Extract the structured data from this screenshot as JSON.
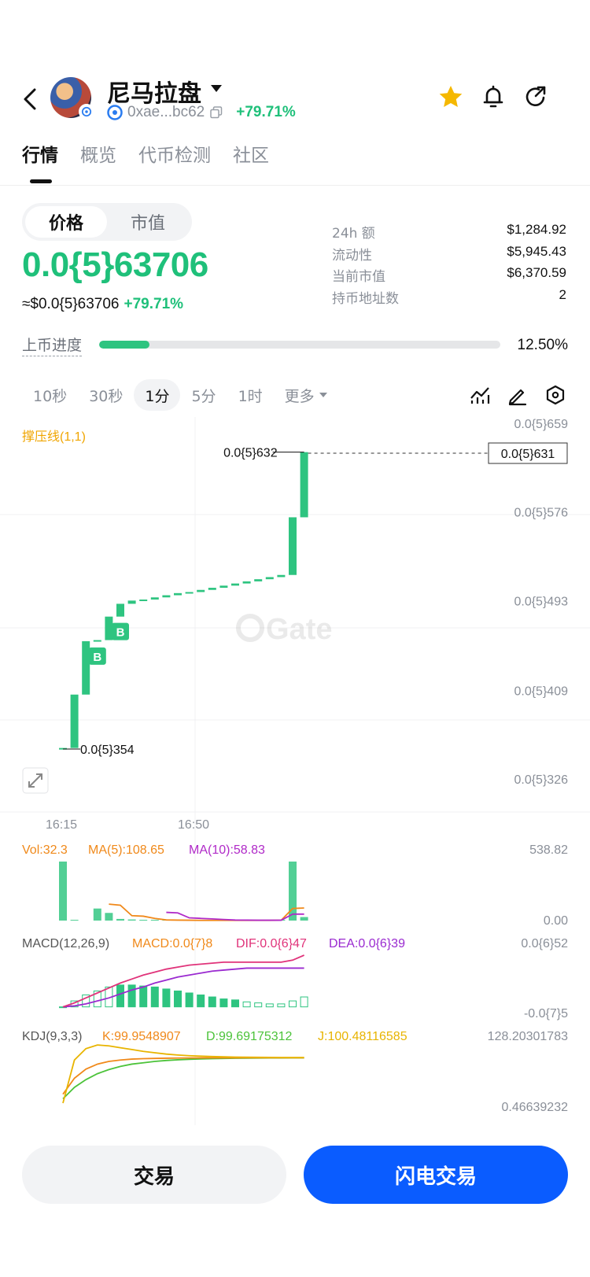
{
  "header": {
    "token_name": "尼马拉盘",
    "address": "0xae...bc62",
    "change": "+79.71%"
  },
  "tabs": [
    {
      "label": "行情",
      "active": true
    },
    {
      "label": "概览",
      "active": false
    },
    {
      "label": "代币检测",
      "active": false
    },
    {
      "label": "社区",
      "active": false
    }
  ],
  "price_toggle": {
    "price_label": "价格",
    "mcap_label": "市值"
  },
  "price": {
    "main": "0.0{5}63706",
    "usd": "≈$0.0{5}63706",
    "change": "+79.71%"
  },
  "stats": [
    {
      "label": "24h  额",
      "value": "$1,284.92"
    },
    {
      "label": "流动性",
      "value": "$5,945.43"
    },
    {
      "label": "当前市值",
      "value": "$6,370.59"
    },
    {
      "label": "持币地址数",
      "value": "2"
    }
  ],
  "progress": {
    "label": "上币进度",
    "value": "12.50%",
    "fraction": 0.125
  },
  "intervals": [
    {
      "label": "10秒",
      "active": false
    },
    {
      "label": "30秒",
      "active": false
    },
    {
      "label": "1分",
      "active": true
    },
    {
      "label": "5分",
      "active": false
    },
    {
      "label": "1时",
      "active": false
    },
    {
      "label": "更多",
      "active": false
    }
  ],
  "colors": {
    "up": "#2ec480",
    "accent_blue": "#0a5cff",
    "star": "#f5b800",
    "sr_line": "#f0a500"
  },
  "chart_data": {
    "type": "candlestick",
    "indicator_label": "撑压线(1,1)",
    "y_ticks": [
      "0.0{5}659",
      "0.0{5}576",
      "0.0{5}493",
      "0.0{5}409",
      "0.0{5}326"
    ],
    "y_tick_values": [
      6.59,
      5.76,
      4.93,
      4.09,
      3.26
    ],
    "x_ticks": [
      "16:15",
      "16:50"
    ],
    "high_label": "0.0{5}632",
    "low_label": "0.0{5}354",
    "current_label": "0.0{5}631",
    "current_value": 6.31,
    "watermark": "Gate",
    "candles": [
      {
        "o": 3.54,
        "c": 3.55
      },
      {
        "o": 3.55,
        "c": 4.05
      },
      {
        "o": 4.05,
        "c": 4.55
      },
      {
        "o": 4.55,
        "c": 4.56
      },
      {
        "o": 4.56,
        "c": 4.78
      },
      {
        "o": 4.78,
        "c": 4.9
      },
      {
        "o": 4.9,
        "c": 4.93
      },
      {
        "o": 4.93,
        "c": 4.94
      },
      {
        "o": 4.94,
        "c": 4.96
      },
      {
        "o": 4.96,
        "c": 4.98
      },
      {
        "o": 4.98,
        "c": 5.0
      },
      {
        "o": 5.0,
        "c": 5.01
      },
      {
        "o": 5.01,
        "c": 5.03
      },
      {
        "o": 5.03,
        "c": 5.05
      },
      {
        "o": 5.05,
        "c": 5.07
      },
      {
        "o": 5.07,
        "c": 5.09
      },
      {
        "o": 5.09,
        "c": 5.11
      },
      {
        "o": 5.11,
        "c": 5.13
      },
      {
        "o": 5.13,
        "c": 5.15
      },
      {
        "o": 5.15,
        "c": 5.17
      },
      {
        "o": 5.17,
        "c": 5.71
      },
      {
        "o": 5.71,
        "c": 6.32
      }
    ],
    "buy_markers": [
      {
        "index": 3,
        "label": "B"
      },
      {
        "index": 5,
        "label": "B"
      }
    ],
    "volume": {
      "label": "Vol:32.3",
      "ma5_label": "MA(5):108.65",
      "ma10_label": "MA(10):58.83",
      "max_label": "538.82",
      "min_label": "0.00",
      "max": 538.82,
      "bars": [
        538.82,
        5,
        0,
        110,
        70,
        15,
        10,
        5,
        3,
        2,
        2,
        2,
        2,
        2,
        2,
        2,
        2,
        2,
        2,
        5,
        538.82,
        32.3
      ],
      "ma5": [
        null,
        null,
        null,
        null,
        150,
        140,
        45,
        40,
        20,
        6,
        4,
        3,
        2,
        2,
        2,
        2,
        2,
        2,
        2,
        3,
        110,
        115
      ],
      "ma10": [
        null,
        null,
        null,
        null,
        null,
        null,
        null,
        null,
        null,
        75,
        70,
        25,
        20,
        15,
        10,
        5,
        4,
        3,
        3,
        3,
        58.83,
        58.83
      ]
    },
    "macd": {
      "label": "MACD(12,26,9)",
      "macd_label": "MACD:0.0{7}8",
      "dif_label": "DIF:0.0{6}47",
      "dea_label": "DEA:0.0{6}39",
      "max_label": "0.0{6}52",
      "min_label": "-0.0{7}5",
      "max": 0.52,
      "min": -0.05,
      "dif": [
        0.0,
        0.04,
        0.09,
        0.14,
        0.19,
        0.24,
        0.28,
        0.32,
        0.35,
        0.38,
        0.4,
        0.42,
        0.43,
        0.44,
        0.45,
        0.45,
        0.45,
        0.45,
        0.45,
        0.45,
        0.47,
        0.52
      ],
      "dea": [
        0.0,
        0.01,
        0.03,
        0.06,
        0.09,
        0.13,
        0.17,
        0.2,
        0.24,
        0.27,
        0.3,
        0.32,
        0.34,
        0.36,
        0.37,
        0.38,
        0.39,
        0.39,
        0.39,
        0.39,
        0.39,
        0.39
      ],
      "hist": [
        0.0,
        0.06,
        0.12,
        0.16,
        0.2,
        0.22,
        0.22,
        0.21,
        0.2,
        0.18,
        0.16,
        0.14,
        0.12,
        0.1,
        0.08,
        0.07,
        0.05,
        0.04,
        0.03,
        0.03,
        0.06,
        0.1
      ]
    },
    "kdj": {
      "label": "KDJ(9,3,3)",
      "k_label": "K:99.9548907",
      "d_label": "D:99.69175312",
      "j_label": "J:100.48116585",
      "max_label": "128.20301783",
      "min_label": "0.46639232",
      "max": 128.2,
      "min": 0.466,
      "k": [
        20,
        55,
        75,
        86,
        92,
        95,
        97,
        98,
        98.5,
        99,
        99.3,
        99.5,
        99.6,
        99.7,
        99.8,
        99.85,
        99.9,
        99.92,
        99.94,
        99.95,
        99.95,
        99.95
      ],
      "d": [
        10,
        35,
        52,
        65,
        74,
        81,
        86,
        89,
        92,
        94,
        95.5,
        96.5,
        97.3,
        98,
        98.5,
        98.9,
        99.2,
        99.4,
        99.55,
        99.65,
        99.69,
        99.69
      ],
      "j": [
        0.47,
        95,
        120,
        128,
        126,
        122,
        118,
        114,
        111,
        108,
        106,
        104.5,
        103.5,
        102.6,
        102,
        101.5,
        101.2,
        100.9,
        100.7,
        100.55,
        100.5,
        100.48
      ]
    }
  },
  "buttons": {
    "trade": "交易",
    "flash_trade": "闪电交易"
  }
}
